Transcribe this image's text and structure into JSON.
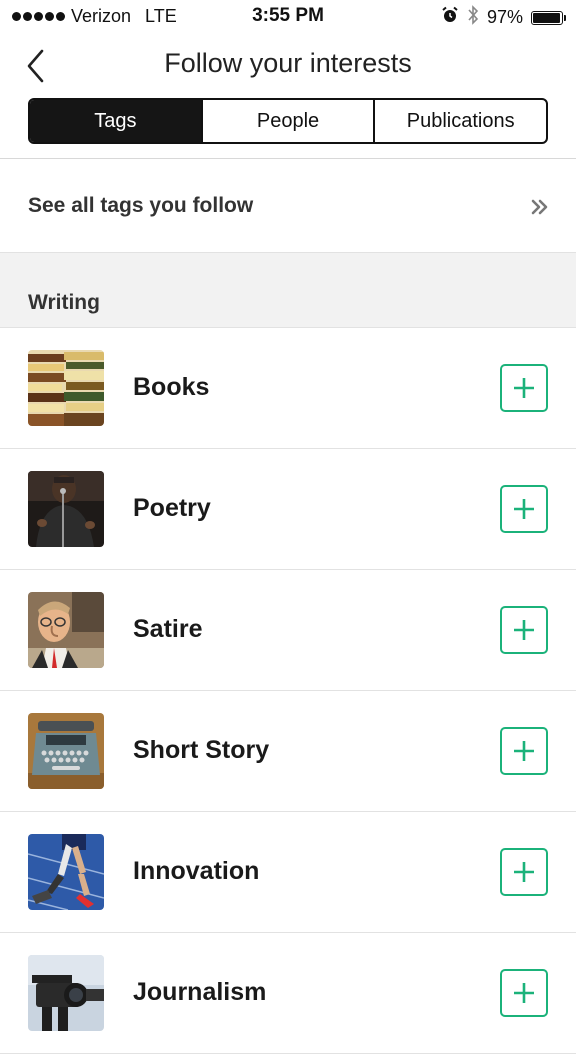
{
  "status_bar": {
    "carrier": "Verizon",
    "network": "LTE",
    "time": "3:55 PM",
    "battery_percent": "97%",
    "battery_level": 0.97
  },
  "header": {
    "title": "Follow your interests"
  },
  "tabs": [
    {
      "label": "Tags",
      "active": true
    },
    {
      "label": "People",
      "active": false
    },
    {
      "label": "Publications",
      "active": false
    }
  ],
  "see_all": {
    "label": "See all tags you follow",
    "icon": "double-chevron-right-icon"
  },
  "section": {
    "title": "Writing"
  },
  "tags": [
    {
      "name": "Books",
      "image": "books-image"
    },
    {
      "name": "Poetry",
      "image": "poetry-image"
    },
    {
      "name": "Satire",
      "image": "satire-image"
    },
    {
      "name": "Short Story",
      "image": "typewriter-image"
    },
    {
      "name": "Innovation",
      "image": "runner-image"
    },
    {
      "name": "Journalism",
      "image": "camera-image"
    }
  ],
  "colors": {
    "accent": "#1bb27a",
    "active_tab": "#151515"
  }
}
